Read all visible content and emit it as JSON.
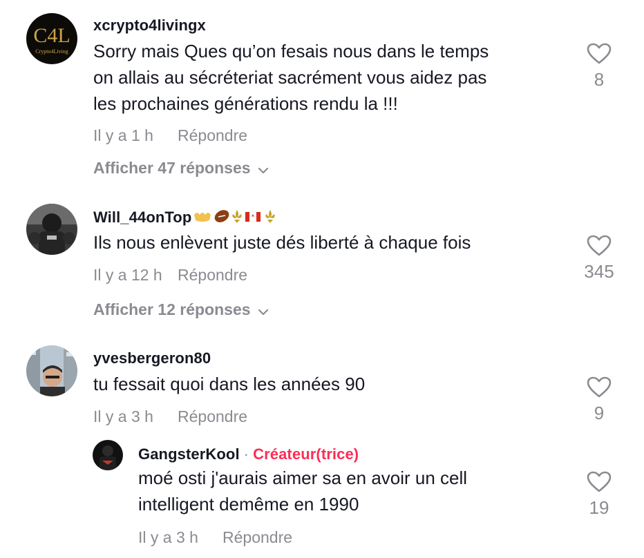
{
  "comments": [
    {
      "username": "xcrypto4livingx",
      "avatar_text": "C4L",
      "avatar_subtext": "Crypto4Living",
      "lines": [
        "Sorry mais Ques qu’on fesais nous dans le temps",
        "on allais au sécréteriat sacrément vous aidez pas",
        "les prochaines générations rendu la !!!"
      ],
      "time": "Il y a 1 h",
      "reply_label": "Répondre",
      "likes": "8",
      "view_replies": "Afficher 47 réponses"
    },
    {
      "username": "Will_44onTop",
      "lines": [
        "Ils nous enlèvent juste dés liberté à chaque fois"
      ],
      "time": "Il y a 12 h",
      "reply_label": "Répondre",
      "likes": "345",
      "view_replies": "Afficher 12 réponses"
    },
    {
      "username": "yvesbergeron80",
      "lines": [
        "tu fessait quoi dans les années 90"
      ],
      "time": "Il y a 3 h",
      "reply_label": "Répondre",
      "likes": "9"
    }
  ],
  "reply": {
    "username": "GangsterKool",
    "separator": "·",
    "creator_label": "Créateur(trice)",
    "lines": [
      "moé osti j'aurais aimer sa en avoir un cell",
      "intelligent demême en 1990"
    ],
    "time": "Il y a 3 h",
    "reply_label": "Répondre",
    "likes": "19"
  },
  "colors": {
    "text": "#161823",
    "muted": "#8a8b91",
    "creator": "#fe2c55"
  },
  "icons": {
    "like": "heart-outline-icon",
    "expand": "chevron-down-icon"
  }
}
